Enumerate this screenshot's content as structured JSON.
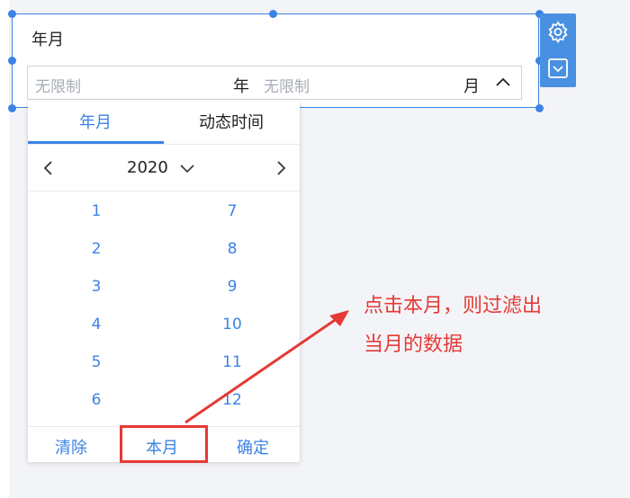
{
  "widget": {
    "title": "年月",
    "range": {
      "start_placeholder": "无限制",
      "start_unit": "年",
      "end_placeholder": "无限制",
      "end_unit": "月",
      "toggle_icon": "chevron-up-icon"
    },
    "tools": {
      "settings_icon": "gear-icon",
      "collapse_icon": "chevron-down-box-icon"
    }
  },
  "picker": {
    "tabs": [
      {
        "label": "年月",
        "active": true
      },
      {
        "label": "动态时间",
        "active": false
      }
    ],
    "year": "2020",
    "months": [
      "1",
      "2",
      "3",
      "4",
      "5",
      "6",
      "7",
      "8",
      "9",
      "10",
      "11",
      "12"
    ],
    "footer": {
      "clear": "清除",
      "this_month": "本月",
      "confirm": "确定"
    }
  },
  "annotation": {
    "line1": "点击本月，则过滤出",
    "line2": "当月的数据",
    "color": "#e53935"
  },
  "colors": {
    "accent": "#3b82e5",
    "annotation": "#e53935"
  }
}
